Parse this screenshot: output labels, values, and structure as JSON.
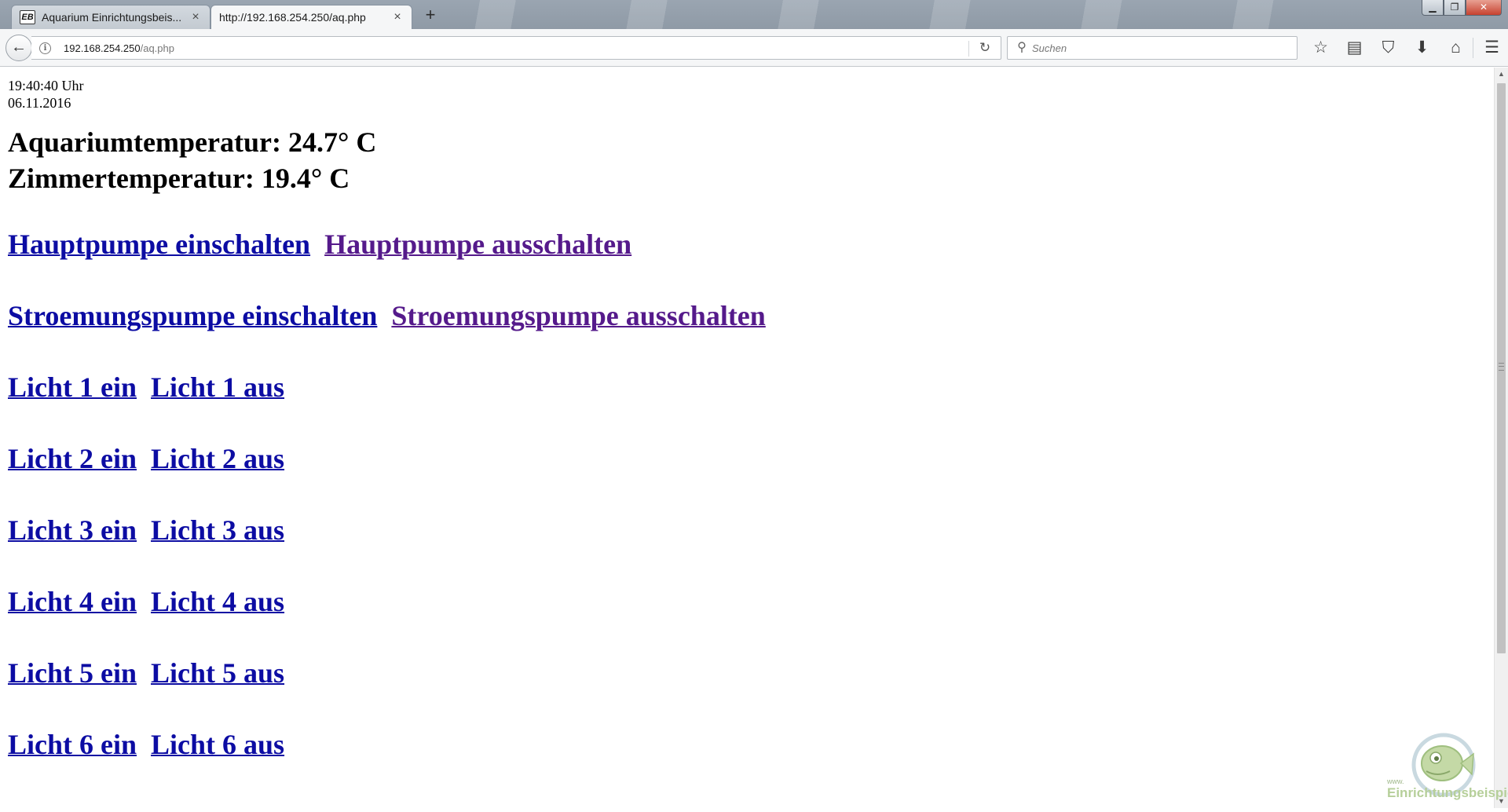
{
  "browser": {
    "tabs": [
      {
        "label": "Aquarium Einrichtungsbeis...",
        "favicon_text": "EB",
        "active": false
      },
      {
        "label": "http://192.168.254.250/aq.php",
        "active": true
      }
    ],
    "url_host": "192.168.254.250",
    "url_path": "/aq.php",
    "search_placeholder": "Suchen",
    "icons": {
      "back": "back-arrow-icon",
      "info": "info-icon",
      "reload": "reload-icon",
      "search": "search-icon",
      "bookmark": "star-icon",
      "reader": "reading-list-icon",
      "pocket": "pocket-icon",
      "download": "download-icon",
      "home": "home-icon",
      "menu": "hamburger-menu-icon"
    }
  },
  "page": {
    "time": "19:40:40 Uhr",
    "date": "06.11.2016",
    "aquarium_temp": "Aquariumtemperatur: 24.7° C",
    "room_temp": "Zimmertemperatur: 19.4° C",
    "controls": [
      {
        "on": "Hauptpumpe einschalten",
        "off": "Hauptpumpe ausschalten",
        "visited_on": false,
        "visited_off": true
      },
      {
        "on": "Stroemungspumpe einschalten",
        "off": "Stroemungspumpe ausschalten",
        "visited_on": false,
        "visited_off": true
      },
      {
        "on": "Licht 1 ein",
        "off": "Licht 1 aus"
      },
      {
        "on": "Licht 2 ein",
        "off": "Licht 2 aus"
      },
      {
        "on": "Licht 3 ein",
        "off": "Licht 3 aus"
      },
      {
        "on": "Licht 4 ein",
        "off": "Licht 4 aus"
      },
      {
        "on": "Licht 5 ein",
        "off": "Licht 5 aus"
      },
      {
        "on": "Licht 6 ein",
        "off": "Licht 6 aus"
      }
    ]
  },
  "watermark": {
    "prefix": "www.",
    "text": "Einrichtungsbeispiele"
  },
  "colors": {
    "link": "#0c0ca3",
    "link_visited": "#551a8b",
    "toolbar_bg": "#f5f6f7"
  }
}
